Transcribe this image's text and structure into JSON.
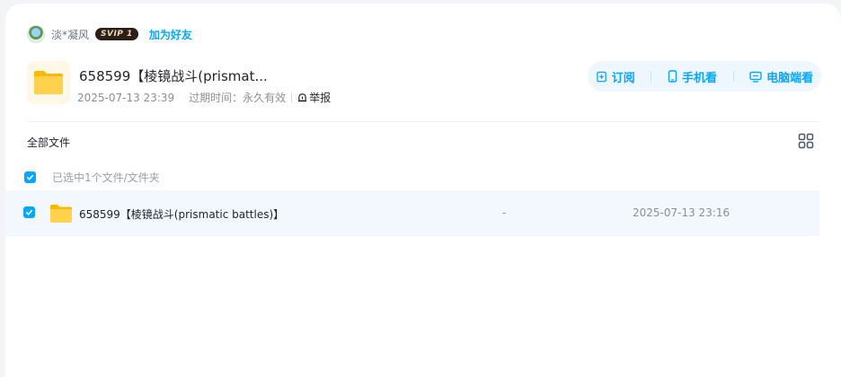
{
  "user": {
    "name": "淡*凝风",
    "badge": "SVIP 1",
    "add_friend": "加为好友"
  },
  "share": {
    "title": "658599【棱镜战斗(prismat...",
    "date": "2025-07-13 23:39",
    "expire_label": "过期时间：",
    "expire_value": "永久有效",
    "report": "举报"
  },
  "actions": {
    "subscribe": "订阅",
    "phone_view": "手机看",
    "pc_view": "电脑端看"
  },
  "list": {
    "all_files": "全部文件",
    "selected_text": "已选中1个文件/文件夹",
    "rows": [
      {
        "name": "658599【棱镜战斗(prismatic battles)】",
        "size": "-",
        "date": "2025-07-13 23:16"
      }
    ]
  },
  "colors": {
    "accent": "#06a7ff",
    "row_selected": "#f2f8fe",
    "folder": "#ffc53d"
  }
}
